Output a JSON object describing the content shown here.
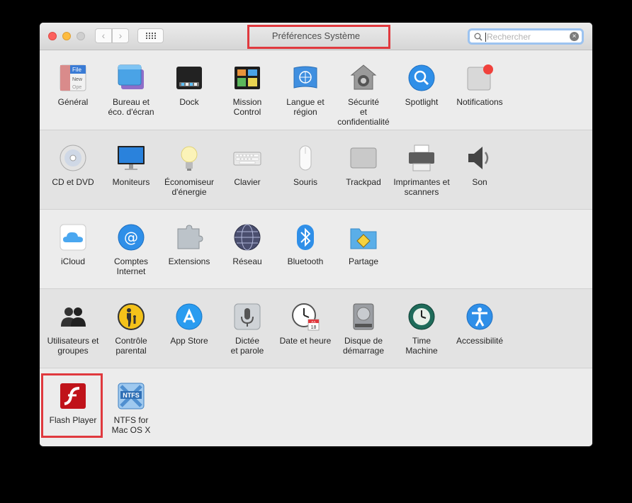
{
  "window": {
    "title": "Préférences Système",
    "search_placeholder": "Rechercher",
    "nav_back_glyph": "‹",
    "nav_forward_glyph": "›",
    "search_clear_glyph": "×"
  },
  "sections": [
    {
      "items": [
        {
          "label": "Général",
          "icon": "general-icon"
        },
        {
          "label": "Bureau et\néco. d'écran",
          "icon": "desktop-icon"
        },
        {
          "label": "Dock",
          "icon": "dock-icon"
        },
        {
          "label": "Mission\nControl",
          "icon": "mission-control-icon"
        },
        {
          "label": "Langue et\nrégion",
          "icon": "language-region-icon"
        },
        {
          "label": "Sécurité\net confidentialité",
          "icon": "security-icon"
        },
        {
          "label": "Spotlight",
          "icon": "spotlight-icon"
        },
        {
          "label": "Notifications",
          "icon": "notifications-icon"
        }
      ]
    },
    {
      "items": [
        {
          "label": "CD et DVD",
          "icon": "cd-dvd-icon"
        },
        {
          "label": "Moniteurs",
          "icon": "displays-icon"
        },
        {
          "label": "Économiseur\nd'énergie",
          "icon": "energy-saver-icon"
        },
        {
          "label": "Clavier",
          "icon": "keyboard-icon"
        },
        {
          "label": "Souris",
          "icon": "mouse-icon"
        },
        {
          "label": "Trackpad",
          "icon": "trackpad-icon"
        },
        {
          "label": "Imprimantes et\nscanners",
          "icon": "printer-icon"
        },
        {
          "label": "Son",
          "icon": "sound-icon"
        }
      ]
    },
    {
      "items": [
        {
          "label": "iCloud",
          "icon": "icloud-icon"
        },
        {
          "label": "Comptes\nInternet",
          "icon": "internet-accounts-icon"
        },
        {
          "label": "Extensions",
          "icon": "extensions-icon"
        },
        {
          "label": "Réseau",
          "icon": "network-icon"
        },
        {
          "label": "Bluetooth",
          "icon": "bluetooth-icon"
        },
        {
          "label": "Partage",
          "icon": "sharing-icon"
        }
      ]
    },
    {
      "items": [
        {
          "label": "Utilisateurs et\ngroupes",
          "icon": "users-groups-icon"
        },
        {
          "label": "Contrôle\nparental",
          "icon": "parental-controls-icon"
        },
        {
          "label": "App Store",
          "icon": "app-store-icon"
        },
        {
          "label": "Dictée\net parole",
          "icon": "dictation-icon"
        },
        {
          "label": "Date et heure",
          "icon": "date-time-icon"
        },
        {
          "label": "Disque de\ndémarrage",
          "icon": "startup-disk-icon"
        },
        {
          "label": "Time\nMachine",
          "icon": "time-machine-icon"
        },
        {
          "label": "Accessibilité",
          "icon": "accessibility-icon"
        }
      ]
    },
    {
      "items": [
        {
          "label": "Flash Player",
          "icon": "flash-player-icon"
        },
        {
          "label": "NTFS for\nMac OS X",
          "icon": "ntfs-icon"
        }
      ]
    }
  ],
  "icon_text": {
    "general_file": "File",
    "general_new": "New",
    "general_open": "Ope",
    "calendar_month": "JUL",
    "calendar_day": "18",
    "ntfs_badge": "NTFS"
  },
  "colors": {
    "highlight": "#e0393e",
    "close": "#fc605c",
    "minimize": "#fdbc40",
    "zoom_disabled": "#cfcfcf",
    "search_focus": "#9cc3f0"
  }
}
